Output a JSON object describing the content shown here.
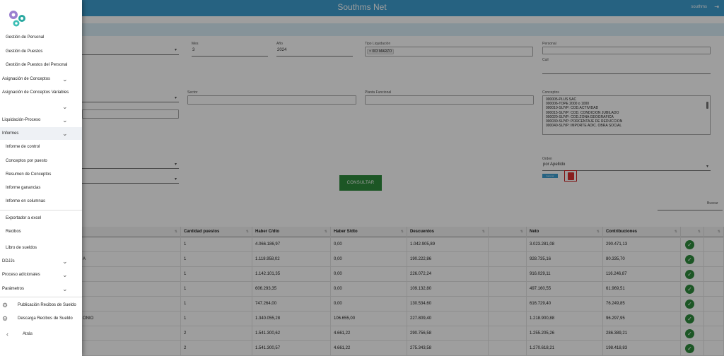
{
  "header": {
    "title": "Southms Net",
    "user": "southms",
    "logout_icon": "logout-icon"
  },
  "form": {
    "mes_label": "Mes",
    "mes_value": "3",
    "anio_label": "Año",
    "anio_value": "2024",
    "tipo_label": "Tipo Liquidación",
    "tipo_chip": "003 MARZO",
    "personal_label": "Personal",
    "cuil_label": "Cuil",
    "sector_label": "Sector",
    "planta_label": "Planta Funcional",
    "conceptos_label": "Conceptos",
    "conceptos": [
      "000005-PLUS SAC",
      "000006-TOPE 2000 o 1000",
      "000010-SIJYP: COD.ACTIVIDAD",
      "000015-SIJYP: COD. CONDICION JUBILADO",
      "000020-SIJYP: COD.ZONA GEOGRAFICA",
      "000030-SIJYP: PORCENTAJE DE REDUCCION",
      "000040-SIJYP: IMPORTE ADIC. OBRA SOCIAL"
    ],
    "consultar_label": "CONSULTAR",
    "orden_label": "Orden",
    "orden_value": "por Apellido",
    "small_btn": "Generar",
    "buscar_label": "Buscar"
  },
  "table": {
    "headers": [
      "Cantidad puestos",
      "Haber C/dto",
      "Haber S/dto",
      "Descuentos",
      "Neto",
      "Contribuciones"
    ],
    "rows": [
      {
        "name": "",
        "cant": "1",
        "hcd": "4.066.186,97",
        "hsd": "0,00",
        "desc": "1.042.905,89",
        "neto": "3.023.281,08",
        "contr": "290.471,13"
      },
      {
        "name": "A",
        "cant": "1",
        "hcd": "1.118.958,02",
        "hsd": "0,00",
        "desc": "190.222,86",
        "neto": "928.735,16",
        "contr": "80.335,70"
      },
      {
        "name": "",
        "cant": "1",
        "hcd": "1.142.101,35",
        "hsd": "0,00",
        "desc": "226.072,24",
        "neto": "916.029,11",
        "contr": "116.246,87"
      },
      {
        "name": "",
        "cant": "1",
        "hcd": "606.293,35",
        "hsd": "0,00",
        "desc": "109.132,80",
        "neto": "497.160,55",
        "contr": "61.969,51"
      },
      {
        "name": "",
        "cant": "1",
        "hcd": "747.264,00",
        "hsd": "0,00",
        "desc": "130.534,60",
        "neto": "616.729,40",
        "contr": "76.249,85"
      },
      {
        "name": "ONIO",
        "cant": "1",
        "hcd": "1.340.055,28",
        "hsd": "106.655,00",
        "desc": "227.809,40",
        "neto": "1.218.900,88",
        "contr": "96.297,95"
      },
      {
        "name": "",
        "cant": "2",
        "hcd": "1.541.300,62",
        "hsd": "4.661,22",
        "desc": "290.756,58",
        "neto": "1.255.205,26",
        "contr": "286.389,21"
      },
      {
        "name": "",
        "cant": "2",
        "hcd": "1.541.300,57",
        "hsd": "4.661,22",
        "desc": "275.343,58",
        "neto": "1.270.618,21",
        "contr": "198.418,83"
      }
    ]
  },
  "sidebar": {
    "items": [
      {
        "label": "Gestión de Personal",
        "kind": "sub"
      },
      {
        "label": "Gestión de Puestos",
        "kind": "sub"
      },
      {
        "label": "Gestión de Puestos del Personal",
        "kind": "sub"
      },
      {
        "label": "Asignación de Conceptos",
        "kind": "top"
      },
      {
        "label": "Asignación de Conceptos Variables",
        "kind": "top"
      },
      {
        "label": "",
        "kind": "top"
      },
      {
        "label": "Liquidación-Proceso",
        "kind": "top"
      },
      {
        "label": "Informes",
        "kind": "top"
      },
      {
        "label": "Informe de control",
        "kind": "sub"
      },
      {
        "label": "Conceptos por puesto",
        "kind": "sub"
      },
      {
        "label": "Resumen de Conceptos",
        "kind": "sub"
      },
      {
        "label": "Informe ganancias",
        "kind": "sub"
      },
      {
        "label": "Informe en columnas",
        "kind": "sub"
      },
      {
        "label": "Exportador a excel",
        "kind": "sub"
      },
      {
        "label": "Recibos",
        "kind": "sub"
      },
      {
        "label": "Libro de sueldos",
        "kind": "sub"
      },
      {
        "label": "DDJJs",
        "kind": "top"
      },
      {
        "label": "Proceso adicionales",
        "kind": "top"
      },
      {
        "label": "Parámetros",
        "kind": "top"
      },
      {
        "label": "Publicación Recibos de Sueldo",
        "kind": "gear"
      },
      {
        "label": "Descarga Recibos de Sueldo",
        "kind": "gear"
      },
      {
        "label": "Atrás",
        "kind": "back"
      }
    ]
  }
}
